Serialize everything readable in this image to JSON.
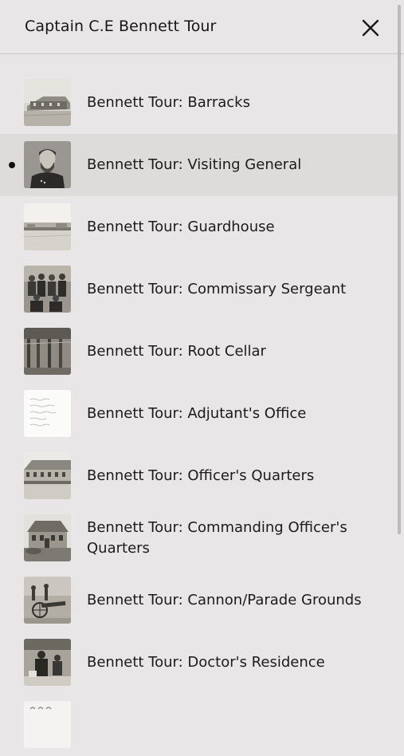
{
  "header": {
    "title": "Captain C.E Bennett Tour",
    "close_icon": "close-icon"
  },
  "tour_stops": [
    {
      "label": "Bennett Tour: Barracks",
      "thumbnail": "barracks-photo",
      "active": false
    },
    {
      "label": "Bennett Tour: Visiting General",
      "thumbnail": "general-portrait-photo",
      "active": true
    },
    {
      "label": "Bennett Tour: Guardhouse",
      "thumbnail": "guardhouse-photo",
      "active": false
    },
    {
      "label": "Bennett Tour: Commissary Sergeant",
      "thumbnail": "sergeant-group-photo",
      "active": false
    },
    {
      "label": "Bennett Tour: Root Cellar",
      "thumbnail": "root-cellar-photo",
      "active": false
    },
    {
      "label": "Bennett Tour: Adjutant's Office",
      "thumbnail": "handwritten-document-photo",
      "active": false
    },
    {
      "label": "Bennett Tour: Officer's Quarters",
      "thumbnail": "officers-quarters-photo",
      "active": false
    },
    {
      "label": "Bennett Tour: Commanding Officer's Quarters",
      "thumbnail": "commanding-quarters-photo",
      "active": false
    },
    {
      "label": "Bennett Tour: Cannon/Parade Grounds",
      "thumbnail": "cannon-photo",
      "active": false
    },
    {
      "label": "Bennett Tour: Doctor's Residence",
      "thumbnail": "doctor-residence-photo",
      "active": false
    },
    {
      "label": "",
      "thumbnail": "partial-photo",
      "active": false
    }
  ]
}
